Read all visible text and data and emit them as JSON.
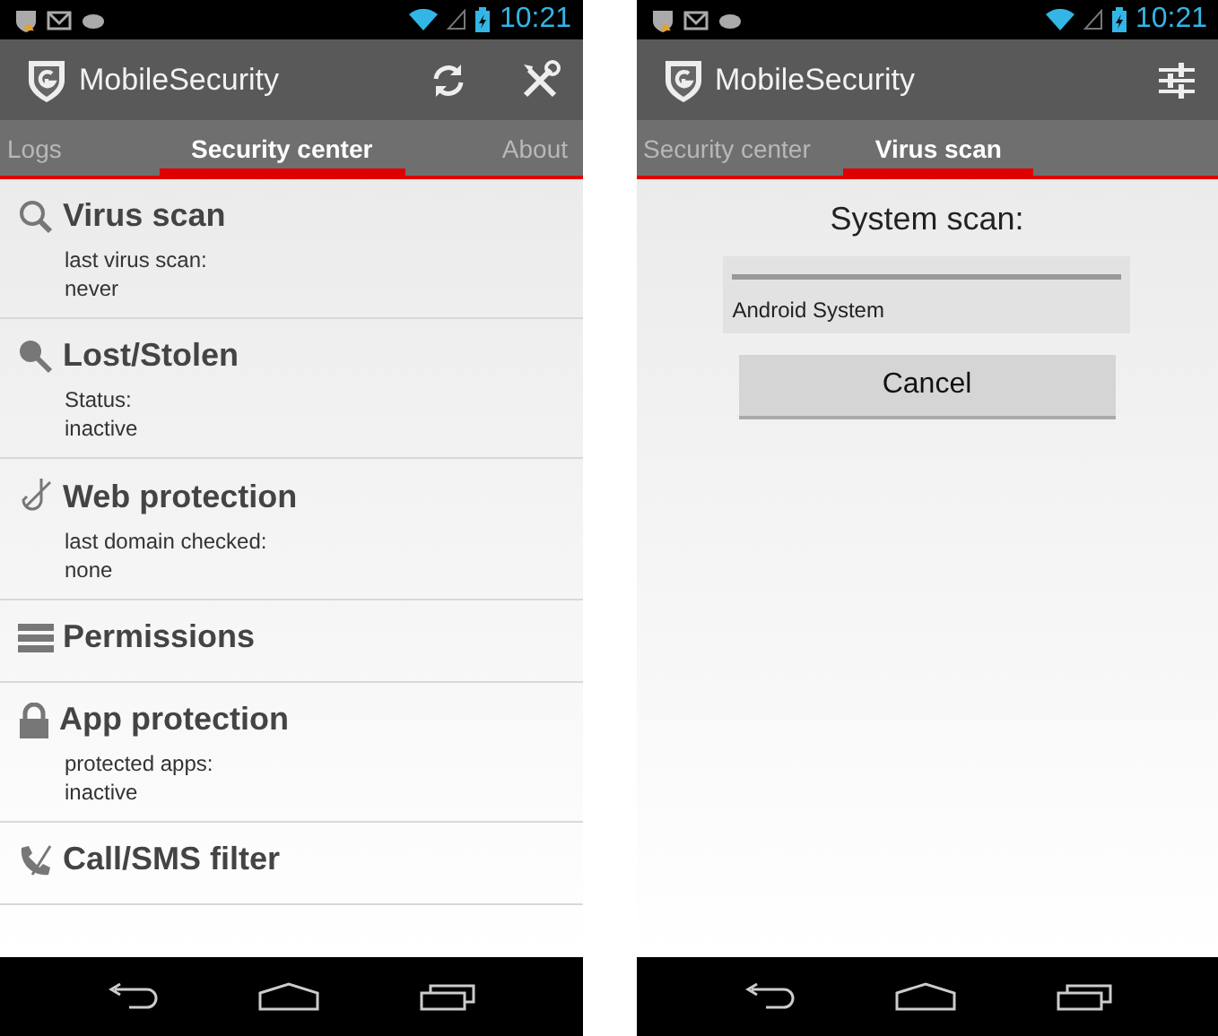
{
  "screens": [
    {
      "status": {
        "time": "10:21"
      },
      "app_title": "MobileSecurity",
      "actions": [
        {
          "kind": "refresh"
        },
        {
          "kind": "tools"
        }
      ],
      "tabs": [
        {
          "label": "Logs",
          "selected": false
        },
        {
          "label": "Security center",
          "selected": true
        },
        {
          "label": "About",
          "selected": false
        }
      ],
      "content": {
        "kind": "list",
        "items": [
          {
            "kind": "search",
            "title": "Virus scan",
            "lines": [
              "last virus scan:",
              "never"
            ]
          },
          {
            "kind": "key",
            "title": "Lost/Stolen",
            "lines": [
              "Status:",
              "inactive"
            ]
          },
          {
            "kind": "hook",
            "title": "Web protection",
            "lines": [
              "last domain checked:",
              "none"
            ]
          },
          {
            "kind": "list",
            "title": "Permissions"
          },
          {
            "kind": "lock",
            "title": "App protection",
            "lines": [
              "protected apps:",
              "inactive"
            ]
          },
          {
            "kind": "phone",
            "title": "Call/SMS filter"
          }
        ]
      }
    },
    {
      "status": {
        "time": "10:21"
      },
      "app_title": "MobileSecurity",
      "actions": [
        {
          "kind": "sliders"
        }
      ],
      "tabs": [
        {
          "label": "Security center",
          "selected": false
        },
        {
          "label": "Virus scan",
          "selected": true
        }
      ],
      "content": {
        "kind": "scan",
        "heading": "System scan:",
        "current": "Android System",
        "button": "Cancel"
      }
    }
  ]
}
